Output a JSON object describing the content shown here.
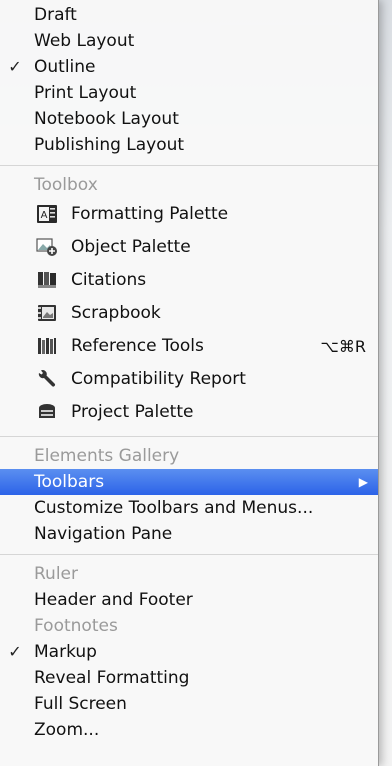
{
  "view_menu": {
    "view_modes": [
      {
        "label": "Draft",
        "checked": false
      },
      {
        "label": "Web Layout",
        "checked": false
      },
      {
        "label": "Outline",
        "checked": true
      },
      {
        "label": "Print Layout",
        "checked": false
      },
      {
        "label": "Notebook Layout",
        "checked": false
      },
      {
        "label": "Publishing Layout",
        "checked": false
      }
    ],
    "toolbox": {
      "header": "Toolbox",
      "items": [
        {
          "label": "Formatting Palette",
          "icon": "formatting-palette-icon"
        },
        {
          "label": "Object Palette",
          "icon": "object-palette-icon"
        },
        {
          "label": "Citations",
          "icon": "citations-icon"
        },
        {
          "label": "Scrapbook",
          "icon": "scrapbook-icon"
        },
        {
          "label": "Reference Tools",
          "icon": "reference-tools-icon",
          "shortcut": "⌥⌘R"
        },
        {
          "label": "Compatibility Report",
          "icon": "wrench-icon"
        },
        {
          "label": "Project Palette",
          "icon": "project-palette-icon"
        }
      ]
    },
    "elements_gallery": "Elements Gallery",
    "toolbars": "Toolbars",
    "customize": "Customize Toolbars and Menus...",
    "navigation_pane": "Navigation Pane",
    "ruler": "Ruler",
    "header_footer": "Header and Footer",
    "footnotes": "Footnotes",
    "markup": "Markup",
    "reveal_formatting": "Reveal Formatting",
    "full_screen": "Full Screen",
    "zoom": "Zoom...",
    "check_mark": "✓",
    "submenu_arrow": "▶",
    "colors": {
      "highlight": "#2c63e8",
      "disabled_text": "#9a9a9a"
    }
  }
}
